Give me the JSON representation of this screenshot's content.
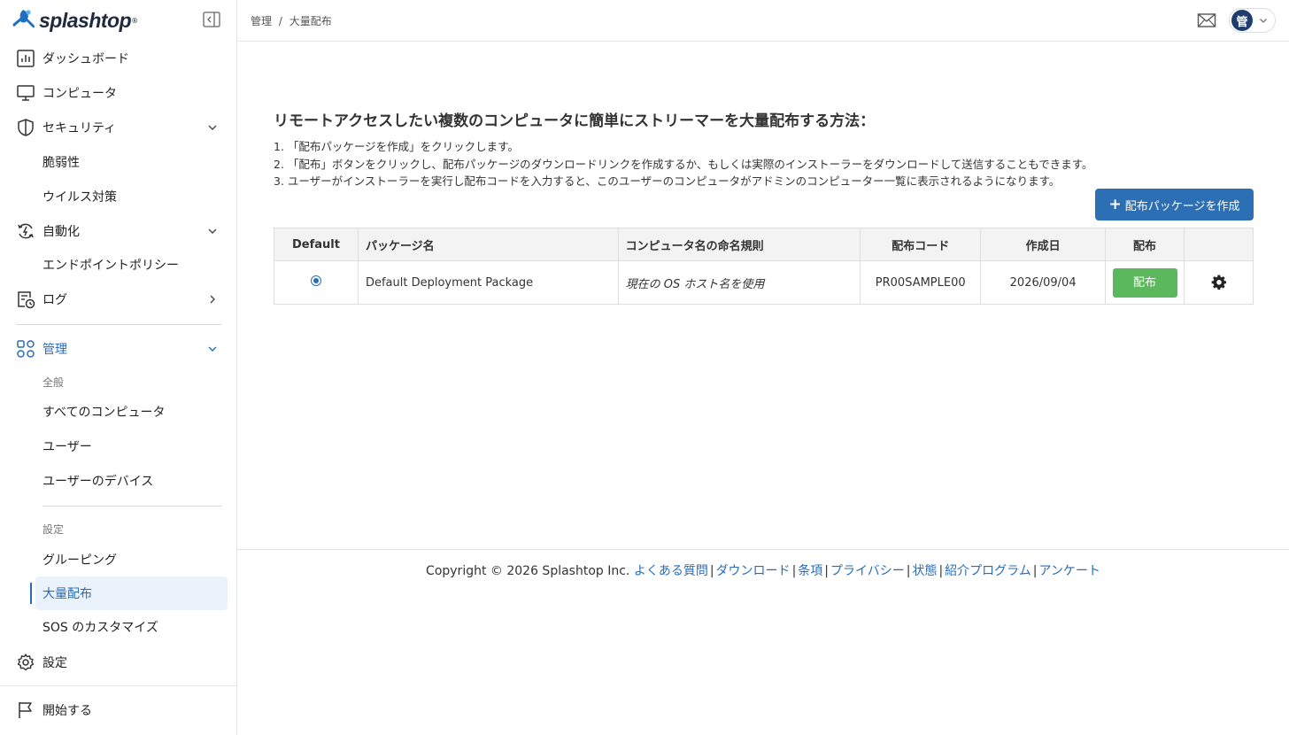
{
  "brand": {
    "name": "splashtop",
    "reg": "®"
  },
  "sidebar": {
    "items": [
      {
        "label": "ダッシュボード"
      },
      {
        "label": "コンピュータ"
      },
      {
        "label": "セキュリティ"
      },
      {
        "label": "脆弱性"
      },
      {
        "label": "ウイルス対策"
      },
      {
        "label": "自動化"
      },
      {
        "label": "エンドポイントポリシー"
      },
      {
        "label": "ログ"
      },
      {
        "label": "管理"
      },
      {
        "label": "全般"
      },
      {
        "label": "すべてのコンピュータ"
      },
      {
        "label": "ユーザー"
      },
      {
        "label": "ユーザーのデバイス"
      },
      {
        "label": "設定"
      },
      {
        "label": "グルーピング"
      },
      {
        "label": "大量配布"
      },
      {
        "label": "SOS のカスタマイズ"
      },
      {
        "label": "設定"
      },
      {
        "label": "開始する"
      }
    ]
  },
  "header": {
    "breadcrumb": [
      "管理",
      "/",
      "大量配布"
    ],
    "avatar_initial": "管"
  },
  "main": {
    "title": "リモートアクセスしたい複数のコンピュータに簡単にストリーマーを大量配布する方法：",
    "steps": [
      "1. 「配布パッケージを作成」をクリックします。",
      "2. 「配布」ボタンをクリックし、配布パッケージのダウンロードリンクを作成するか、もしくは実際のインストーラーをダウンロードして送信することもできます。",
      "3. ユーザーがインストーラーを実行し配布コードを入力すると、このユーザーのコンピュータがアドミンのコンピューター一覧に表示されるようになります。"
    ],
    "create_button": "配布パッケージを作成",
    "table": {
      "headers": [
        "Default",
        "パッケージ名",
        "コンピュータ名の命名規則",
        "配布コード",
        "作成日",
        "配布",
        ""
      ],
      "rows": [
        {
          "name": "Default Deployment Package",
          "rule": "現在の OS ホスト名を使用",
          "code": "PR00SAMPLE00",
          "date": "2026/09/04",
          "deploy": "配布"
        }
      ]
    }
  },
  "footer": {
    "copyright": "Copyright © 2026 Splashtop Inc.",
    "links": [
      "よくある質問",
      "ダウンロード",
      "条項",
      "プライバシー",
      "状態",
      "紹介プログラム",
      "アンケート"
    ],
    "separator": "|"
  },
  "colors": {
    "accent": "#2b6cb8",
    "primary_button": "#2d6fb5",
    "deploy_button": "#5cb85c"
  }
}
